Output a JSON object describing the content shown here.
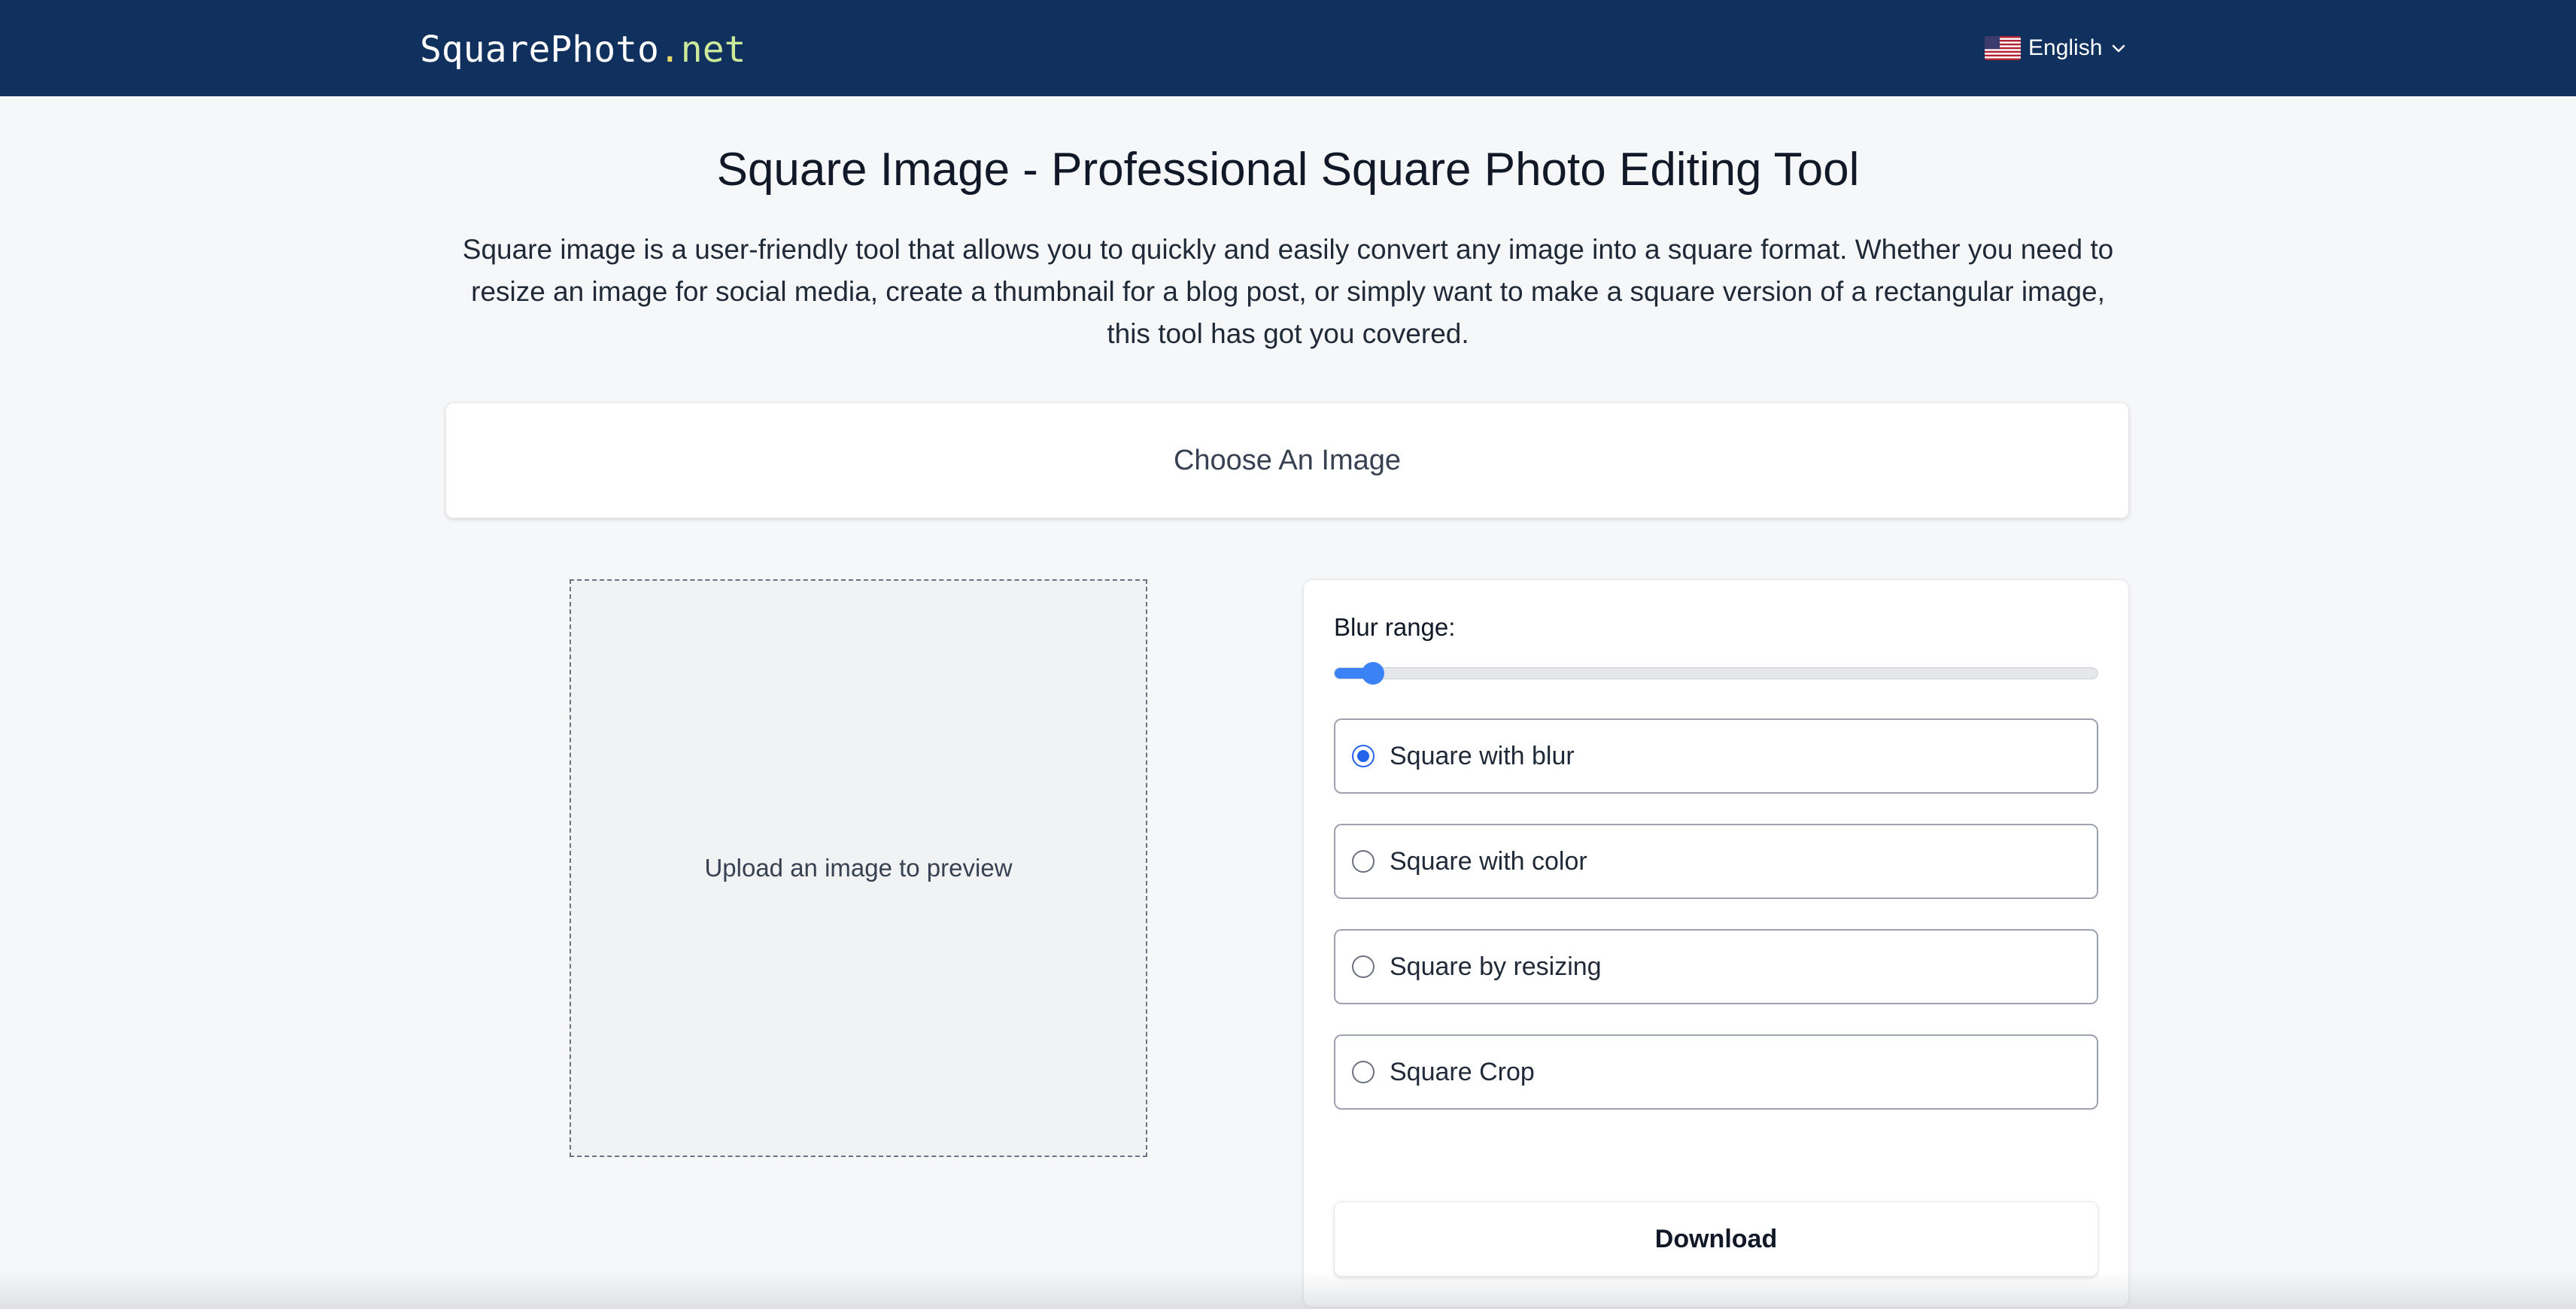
{
  "header": {
    "logo": {
      "name": "SquarePhoto",
      "dot": ".",
      "tld": "net"
    },
    "language": {
      "label": "English",
      "flag_icon": "us-flag-icon",
      "chevron_icon": "chevron-down-icon"
    }
  },
  "main": {
    "title": "Square Image - Professional Square Photo Editing Tool",
    "description": "Square image is a user-friendly tool that allows you to quickly and easily convert any image into a square format. Whether you need to resize an image for social media, create a thumbnail for a blog post, or simply want to make a square version of a rectangular image, this tool has got you covered.",
    "choose_label": "Choose An Image",
    "preview_placeholder": "Upload an image to preview"
  },
  "panel": {
    "blur_label": "Blur range:",
    "blur_value_fraction": 0.05,
    "options": [
      {
        "label": "Square with blur",
        "checked": true
      },
      {
        "label": "Square with color",
        "checked": false
      },
      {
        "label": "Square by resizing",
        "checked": false
      },
      {
        "label": "Square Crop",
        "checked": false
      }
    ],
    "download_label": "Download"
  },
  "colors": {
    "header_bg": "#10305e",
    "accent": "#3b82f6",
    "logo_dot": "#e8d96a",
    "logo_tld": "#cdea9a"
  }
}
